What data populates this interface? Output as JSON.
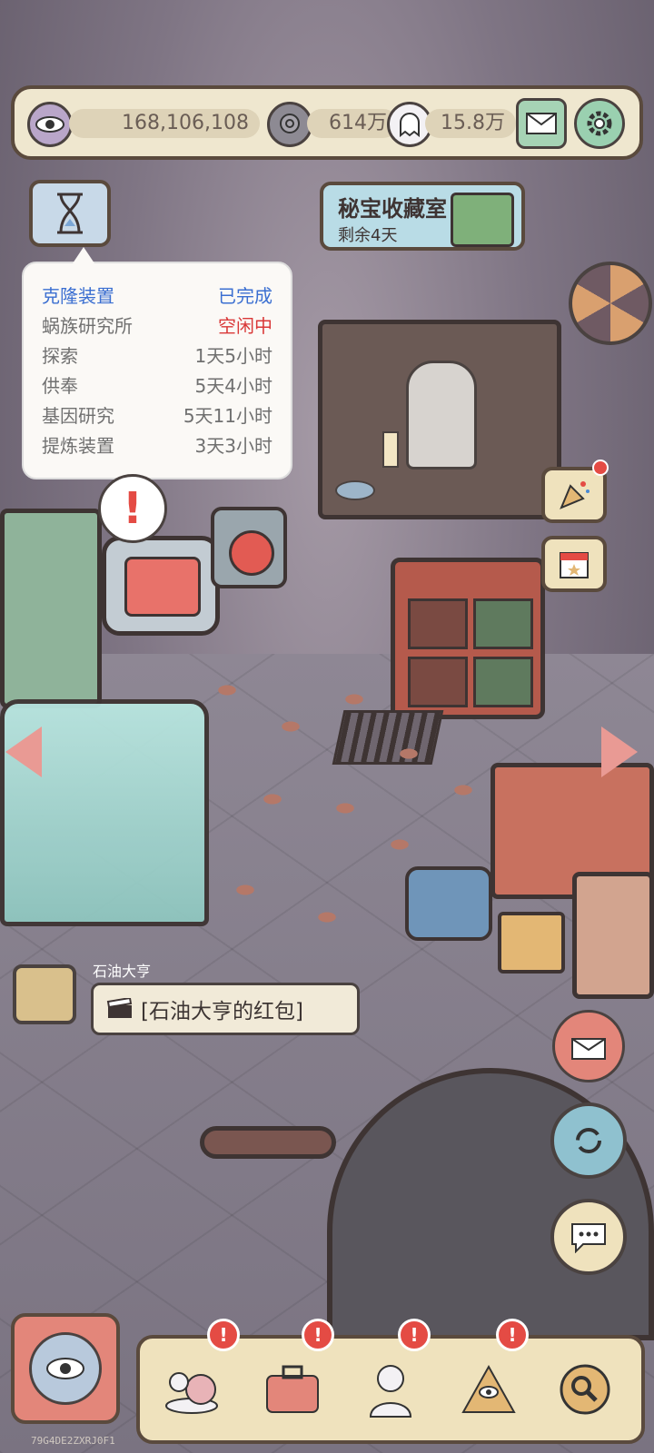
{
  "topbar": {
    "eye_value": "168,106,108",
    "snail_value": "614万",
    "ghost_value": "15.8万",
    "icons": [
      "eye-icon",
      "snail-currency-icon",
      "ghost-currency-icon",
      "mail-icon",
      "gear-icon"
    ]
  },
  "event_banner": {
    "title": "秘宝收藏室",
    "subtitle": "剩余4天"
  },
  "timer_panel": {
    "rows": [
      {
        "name": "克隆装置",
        "status": "已完成",
        "name_color": "#3b6fd1",
        "status_color": "#3b6fd1"
      },
      {
        "name": "蜗族研究所",
        "status": "空闲中",
        "status_color": "#d93838"
      },
      {
        "name": "探索",
        "status": "1天5小时"
      },
      {
        "name": "供奉",
        "status": "5天4小时"
      },
      {
        "name": "基因研究",
        "status": "5天11小时"
      },
      {
        "name": "提炼装置",
        "status": "3天3小时"
      }
    ]
  },
  "chat": {
    "sender": "石油大亨",
    "message": "[石油大亨的红包]"
  },
  "footer": {
    "watermark": "79G4DE2ZXRJ0F1"
  },
  "colors": {
    "accent_red": "#e44b44",
    "panel_cream": "#efe2bd",
    "border_brown": "#5a4a3d"
  }
}
